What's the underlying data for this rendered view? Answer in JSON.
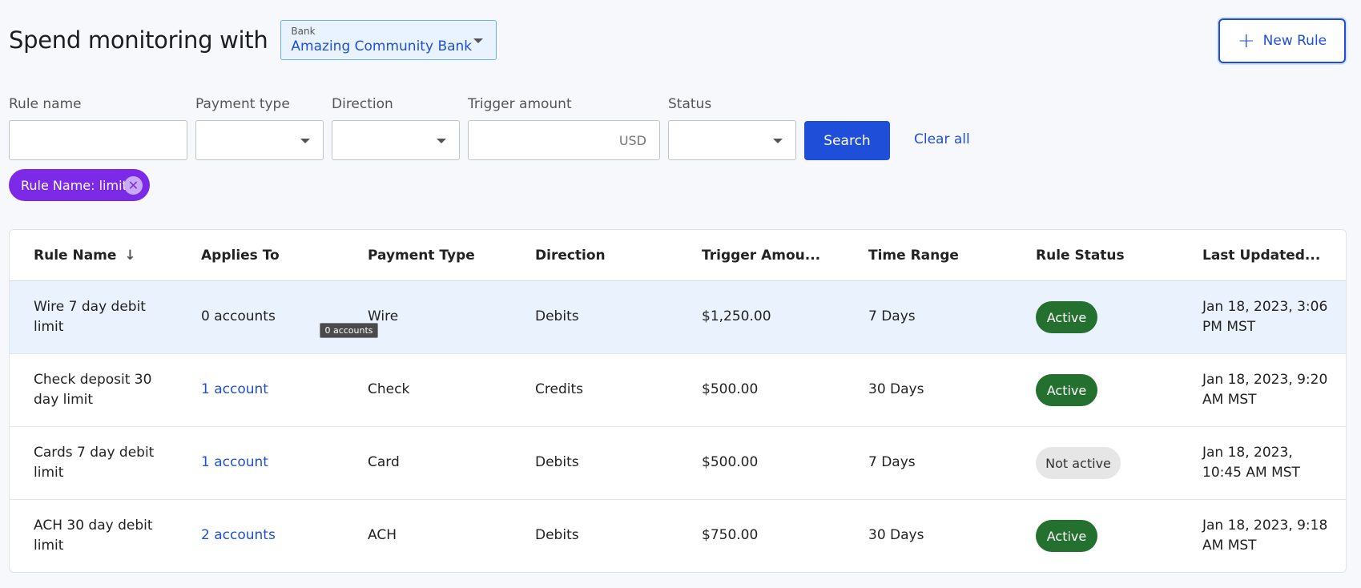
{
  "header": {
    "title": "Spend monitoring with",
    "bank_label": "Bank",
    "bank_value": "Amazing Community Bank",
    "new_rule_label": "New Rule"
  },
  "filters": {
    "rule_name_label": "Rule name",
    "rule_name_value": "",
    "payment_type_label": "Payment type",
    "direction_label": "Direction",
    "trigger_amount_label": "Trigger amount",
    "currency": "USD",
    "status_label": "Status",
    "search_label": "Search",
    "clear_label": "Clear all"
  },
  "chip": {
    "label": "Rule Name: limit",
    "close_glyph": "✕"
  },
  "table": {
    "columns": [
      "Rule Name",
      "Applies To",
      "Payment Type",
      "Direction",
      "Trigger Amou...",
      "Time Range",
      "Rule Status",
      "Last Updated..."
    ],
    "rows": [
      {
        "rule_name": "Wire 7 day debit limit",
        "applies_to": "0 accounts",
        "payment_type": "Wire",
        "direction": "Debits",
        "trigger_amount": "$1,250.00",
        "time_range": "7 Days",
        "status": "Active",
        "last_updated": "Jan 18, 2023, 3:06 PM MST"
      },
      {
        "rule_name": "Check deposit 30 day limit",
        "applies_to": "1 account",
        "payment_type": "Check",
        "direction": "Credits",
        "trigger_amount": "$500.00",
        "time_range": "30 Days",
        "status": "Active",
        "last_updated": "Jan 18, 2023, 9:20 AM MST"
      },
      {
        "rule_name": "Cards 7 day debit limit",
        "applies_to": "1 account",
        "payment_type": "Card",
        "direction": "Debits",
        "trigger_amount": "$500.00",
        "time_range": "7 Days",
        "status": "Not active",
        "last_updated": "Jan 18, 2023, 10:45 AM MST"
      },
      {
        "rule_name": "ACH 30 day debit limit",
        "applies_to": "2 accounts",
        "payment_type": "ACH",
        "direction": "Debits",
        "trigger_amount": "$750.00",
        "time_range": "30 Days",
        "status": "Active",
        "last_updated": "Jan 18, 2023, 9:18 AM MST"
      }
    ],
    "tooltip": "0 accounts"
  },
  "colors": {
    "primary": "#1f4fd8",
    "chip": "#7c2ae8",
    "active": "#24702f",
    "highlight_row": "#eaf3fd"
  }
}
